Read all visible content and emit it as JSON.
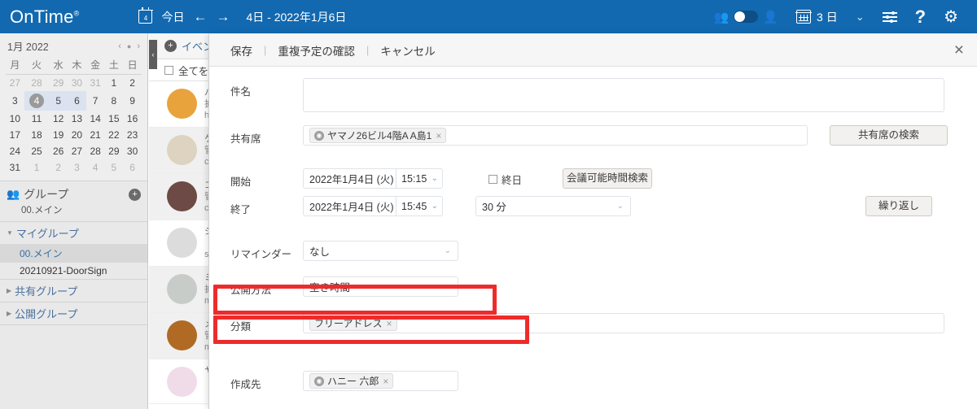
{
  "topbar": {
    "brand": "OnTime",
    "brand_reg": "®",
    "calendar_icon_number": "4",
    "today_label": "今日",
    "prev_arrow": "←",
    "next_arrow": "→",
    "date_range": "4日 - 2022年1月6日",
    "people_icon": "people-icon",
    "toggle_state": "on",
    "person_icon": "person-icon",
    "view_label": "3 日",
    "chevron": "⌄",
    "filter_icon": "sliders-icon",
    "help_label": "?",
    "settings_icon": "gear-icon"
  },
  "sidebar": {
    "mini_calendar": {
      "title": "1月 2022",
      "prev": "‹",
      "dot": "●",
      "next": "›",
      "weekdays": [
        "月",
        "火",
        "水",
        "木",
        "金",
        "土",
        "日"
      ],
      "weeks": [
        [
          {
            "d": "27",
            "s": "out"
          },
          {
            "d": "28",
            "s": "out"
          },
          {
            "d": "29",
            "s": "out"
          },
          {
            "d": "30",
            "s": "out"
          },
          {
            "d": "31",
            "s": "out"
          },
          {
            "d": "1",
            "s": ""
          },
          {
            "d": "2",
            "s": ""
          }
        ],
        [
          {
            "d": "3",
            "s": ""
          },
          {
            "d": "4",
            "s": "sel today"
          },
          {
            "d": "5",
            "s": "sel"
          },
          {
            "d": "6",
            "s": "sel"
          },
          {
            "d": "7",
            "s": ""
          },
          {
            "d": "8",
            "s": ""
          },
          {
            "d": "9",
            "s": ""
          }
        ],
        [
          {
            "d": "10",
            "s": ""
          },
          {
            "d": "11",
            "s": ""
          },
          {
            "d": "12",
            "s": ""
          },
          {
            "d": "13",
            "s": ""
          },
          {
            "d": "14",
            "s": ""
          },
          {
            "d": "15",
            "s": ""
          },
          {
            "d": "16",
            "s": ""
          }
        ],
        [
          {
            "d": "17",
            "s": ""
          },
          {
            "d": "18",
            "s": ""
          },
          {
            "d": "19",
            "s": ""
          },
          {
            "d": "20",
            "s": ""
          },
          {
            "d": "21",
            "s": ""
          },
          {
            "d": "22",
            "s": ""
          },
          {
            "d": "23",
            "s": ""
          }
        ],
        [
          {
            "d": "24",
            "s": ""
          },
          {
            "d": "25",
            "s": ""
          },
          {
            "d": "26",
            "s": ""
          },
          {
            "d": "27",
            "s": ""
          },
          {
            "d": "28",
            "s": ""
          },
          {
            "d": "29",
            "s": ""
          },
          {
            "d": "30",
            "s": ""
          }
        ],
        [
          {
            "d": "31",
            "s": ""
          },
          {
            "d": "1",
            "s": "out"
          },
          {
            "d": "2",
            "s": "out"
          },
          {
            "d": "3",
            "s": "out"
          },
          {
            "d": "4",
            "s": "out"
          },
          {
            "d": "5",
            "s": "out"
          },
          {
            "d": "6",
            "s": "out"
          }
        ]
      ]
    },
    "group_section": {
      "icon": "group-icon",
      "title": "グループ",
      "add_label": "+",
      "subtitle": "00.メイン"
    },
    "tree": [
      {
        "type": "node",
        "label": "マイグループ",
        "twisty": "▼"
      },
      {
        "type": "child",
        "label": "00.メイン",
        "active": true
      },
      {
        "type": "child",
        "label": "20210921-DoorSign",
        "active": false
      },
      {
        "type": "node",
        "label": "共有グループ",
        "twisty": "▶"
      },
      {
        "type": "node",
        "label": "公開グループ",
        "twisty": "▶"
      }
    ]
  },
  "event_list": {
    "collapse_handle": "‹",
    "add_event_label": "イベント",
    "add_icon": "plus-circle-icon",
    "select_all_label": "全てを選",
    "rows": [
      {
        "avatar": "#e8a33d",
        "line1": "ハ",
        "line2": "拡",
        "line3": "h"
      },
      {
        "avatar": "#ded2c0",
        "line1": "ケ",
        "line2": "管",
        "line3": "c"
      },
      {
        "avatar": "#6d4a46",
        "line1": "コ",
        "line2": "管",
        "line3": "c"
      },
      {
        "avatar": "#dcdcdc",
        "line1": "シ",
        "line2": "",
        "line3": "s"
      },
      {
        "avatar": "#c8ccc8",
        "line1": "ミ",
        "line2": "拡",
        "line3": "m"
      },
      {
        "avatar": "#b06a24",
        "line1": "メ",
        "line2": "管",
        "line3": "m"
      },
      {
        "avatar": "#f0dce8",
        "line1": "ヤ",
        "line2": "",
        "line3": ""
      }
    ]
  },
  "modal": {
    "actions": {
      "save": "保存",
      "check_conflicts": "重複予定の確認",
      "cancel": "キャンセル",
      "separator": "|",
      "close_icon": "×"
    },
    "fields": {
      "subject": {
        "label": "件名",
        "value": "",
        "placeholder": ""
      },
      "shared_seat": {
        "label": "共有席",
        "token": "ヤマノ26ビル4階A A島1",
        "token_icon": "location-icon",
        "token_remove": "×",
        "search_button": "共有席の検索"
      },
      "start": {
        "label": "開始",
        "date": "2022年1月4日 (火)",
        "time": "15:15",
        "chevron": "⌄"
      },
      "end": {
        "label": "終了",
        "date": "2022年1月4日 (火)",
        "time": "15:45",
        "chevron": "⌄"
      },
      "all_day": {
        "label": "終日",
        "checked": false
      },
      "find_meeting_time_button": "会議可能時間検索",
      "duration": {
        "value": "30 分",
        "chevron": "⌄"
      },
      "repeat_button": "繰り返し",
      "reminder": {
        "label": "リマインダー",
        "value": "なし",
        "chevron": "⌄"
      },
      "visibility": {
        "label": "公開方法",
        "value": "空き時間",
        "chevron": "⌄"
      },
      "category": {
        "label": "分類",
        "token": "フリーアドレス",
        "token_remove": "×"
      },
      "create_in": {
        "label": "作成先",
        "token": "ハニー 六郎",
        "token_icon": "user-icon",
        "token_remove": "×"
      }
    }
  },
  "highlights": {
    "color": "#ee2b2b",
    "boxes": [
      "visibility-row",
      "category-row"
    ]
  }
}
